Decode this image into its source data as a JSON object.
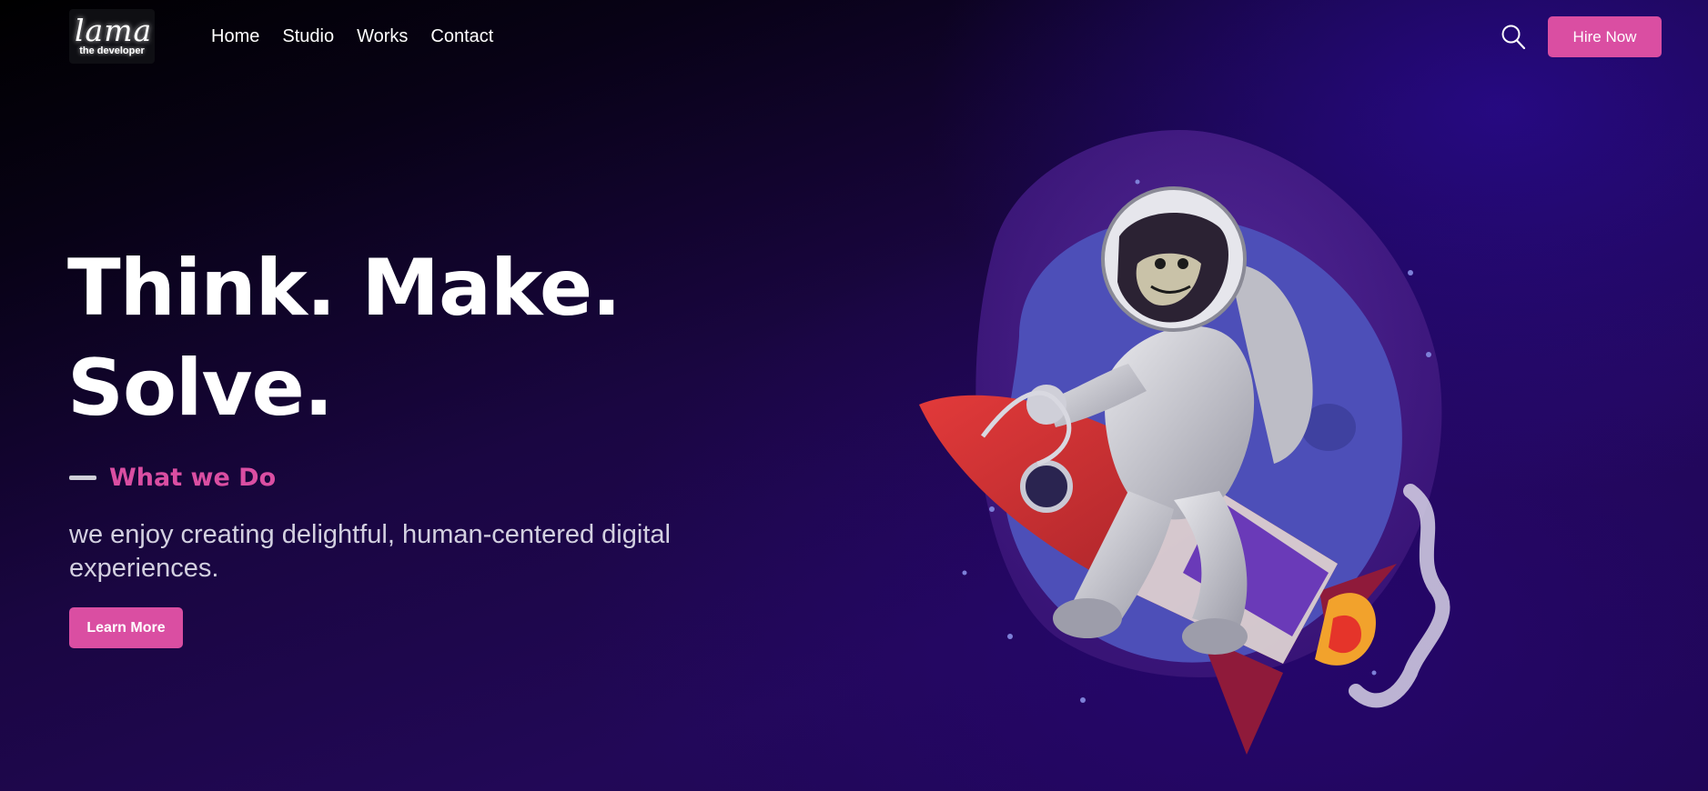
{
  "header": {
    "logo": {
      "title": "lama",
      "subtitle": "the developer"
    },
    "nav": [
      {
        "label": "Home"
      },
      {
        "label": "Studio"
      },
      {
        "label": "Works"
      },
      {
        "label": "Contact"
      }
    ],
    "search_icon": "search-icon",
    "hire_label": "Hire Now"
  },
  "hero": {
    "title_line1": "Think. Make.",
    "title_line2": "Solve.",
    "subtitle": "What we Do",
    "description": "we enjoy creating delightful, human-centered digital experiences.",
    "cta_label": "Learn More",
    "illustration": "astronaut-riding-rocket"
  },
  "colors": {
    "accent": "#da4ea2",
    "background_dark": "#000000",
    "background_purple": "#220857",
    "text": "#ffffff",
    "text_muted": "#d3d0e0"
  }
}
